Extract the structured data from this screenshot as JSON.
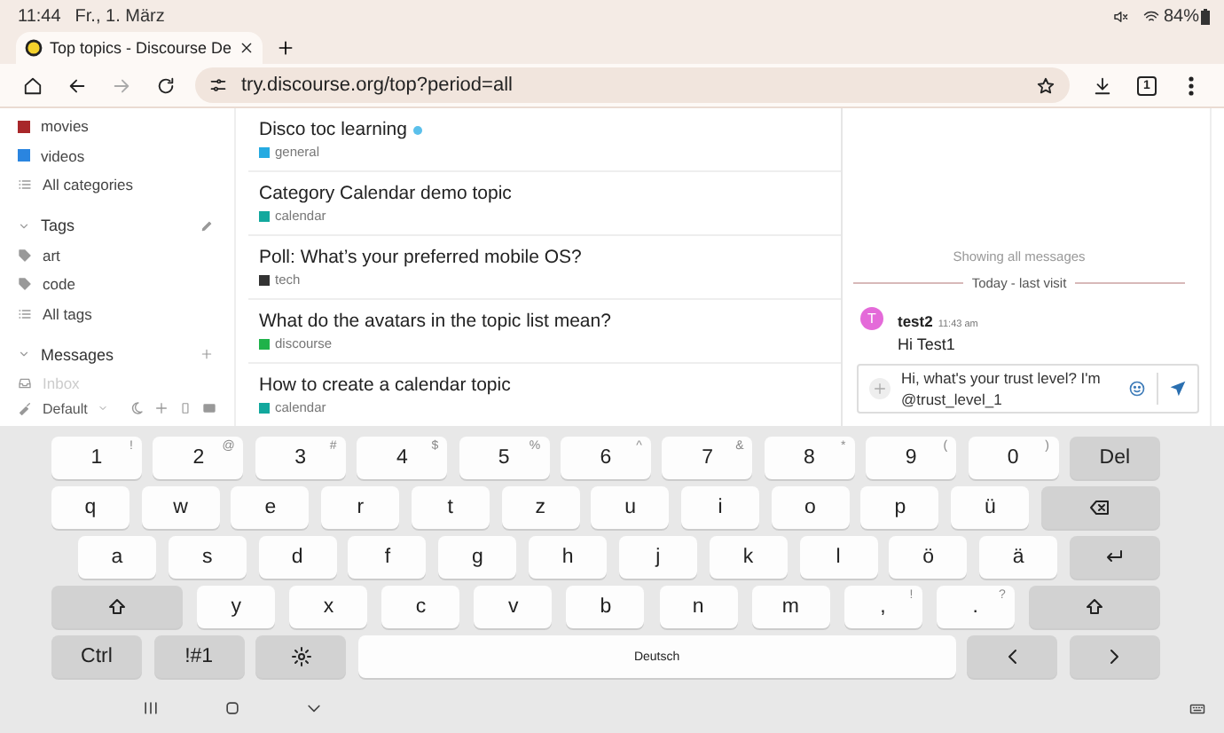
{
  "status_bar": {
    "time": "11:44",
    "date": "Fr., 1. März",
    "battery": "84%"
  },
  "browser": {
    "tab_title": "Top topics - Discourse De",
    "url": "try.discourse.org/top?period=all",
    "tab_count": "1",
    "forward_enabled": false
  },
  "sidebar": {
    "categories": [
      {
        "label": "movies",
        "color": "#a8272a"
      },
      {
        "label": "videos",
        "color": "#2a85e0"
      }
    ],
    "all_categories": "All categories",
    "tags": {
      "title": "Tags",
      "expanded": true,
      "items": [
        "art",
        "code"
      ],
      "all": "All tags"
    },
    "messages": {
      "title": "Messages",
      "expanded": true,
      "items": [
        "Inbox"
      ]
    },
    "footer": {
      "theme": "Default"
    }
  },
  "topics": [
    {
      "title": "Disco toc learning",
      "category": "general",
      "color": "#25aae1",
      "unread": true
    },
    {
      "title": "Category Calendar demo topic",
      "category": "calendar",
      "color": "#12a89d",
      "unread": false
    },
    {
      "title": "Poll: What’s your preferred mobile OS?",
      "category": "tech",
      "color": "#333333",
      "unread": false
    },
    {
      "title": "What do the avatars in the topic list mean?",
      "category": "discourse",
      "color": "#1fb24a",
      "unread": false
    },
    {
      "title": "How to create a calendar topic",
      "category": "calendar",
      "color": "#12a89d",
      "unread": false
    }
  ],
  "chat": {
    "notice": "Showing all messages",
    "divider": "Today - last visit",
    "messages": [
      {
        "avatar": "T",
        "user": "test2",
        "time": "11:43 am",
        "text": "Hi Test1"
      }
    ],
    "composer": {
      "value": "Hi, what's your trust level? I'm @trust_level_1"
    }
  },
  "keyboard": {
    "rows": [
      {
        "keys": [
          {
            "kind": "char",
            "label": "1",
            "hint": "!"
          },
          {
            "kind": "char",
            "label": "2",
            "hint": "@"
          },
          {
            "kind": "char",
            "label": "3",
            "hint": "#"
          },
          {
            "kind": "char",
            "label": "4",
            "hint": "$"
          },
          {
            "kind": "char",
            "label": "5",
            "hint": "%"
          },
          {
            "kind": "char",
            "label": "6",
            "hint": "^"
          },
          {
            "kind": "char",
            "label": "7",
            "hint": "&"
          },
          {
            "kind": "char",
            "label": "8",
            "hint": "*"
          },
          {
            "kind": "char",
            "label": "9",
            "hint": "("
          },
          {
            "kind": "char",
            "label": "0",
            "hint": ")"
          },
          {
            "kind": "fn",
            "label": "Del"
          }
        ]
      },
      {
        "keys": [
          {
            "kind": "char",
            "label": "q"
          },
          {
            "kind": "char",
            "label": "w"
          },
          {
            "kind": "char",
            "label": "e"
          },
          {
            "kind": "char",
            "label": "r"
          },
          {
            "kind": "char",
            "label": "t"
          },
          {
            "kind": "char",
            "label": "z"
          },
          {
            "kind": "char",
            "label": "u"
          },
          {
            "kind": "char",
            "label": "i"
          },
          {
            "kind": "char",
            "label": "o"
          },
          {
            "kind": "char",
            "label": "p"
          },
          {
            "kind": "char",
            "label": "ü"
          },
          {
            "kind": "backspace"
          }
        ]
      },
      {
        "keys": [
          {
            "kind": "char",
            "label": "a"
          },
          {
            "kind": "char",
            "label": "s"
          },
          {
            "kind": "char",
            "label": "d"
          },
          {
            "kind": "char",
            "label": "f"
          },
          {
            "kind": "char",
            "label": "g"
          },
          {
            "kind": "char",
            "label": "h"
          },
          {
            "kind": "char",
            "label": "j"
          },
          {
            "kind": "char",
            "label": "k"
          },
          {
            "kind": "char",
            "label": "l"
          },
          {
            "kind": "char",
            "label": "ö"
          },
          {
            "kind": "char",
            "label": "ä"
          },
          {
            "kind": "enter"
          }
        ]
      },
      {
        "keys": [
          {
            "kind": "shift"
          },
          {
            "kind": "char",
            "label": "y"
          },
          {
            "kind": "char",
            "label": "x"
          },
          {
            "kind": "char",
            "label": "c"
          },
          {
            "kind": "char",
            "label": "v"
          },
          {
            "kind": "char",
            "label": "b"
          },
          {
            "kind": "char",
            "label": "n"
          },
          {
            "kind": "char",
            "label": "m"
          },
          {
            "kind": "char",
            "label": ",",
            "hint": "!"
          },
          {
            "kind": "char",
            "label": ".",
            "hint": "?"
          },
          {
            "kind": "shift"
          }
        ]
      },
      {
        "keys": [
          {
            "kind": "fn",
            "label": "Ctrl"
          },
          {
            "kind": "fn",
            "label": "!#1"
          },
          {
            "kind": "settings"
          },
          {
            "kind": "space",
            "label": "Deutsch"
          },
          {
            "kind": "left"
          },
          {
            "kind": "right"
          }
        ]
      }
    ]
  }
}
